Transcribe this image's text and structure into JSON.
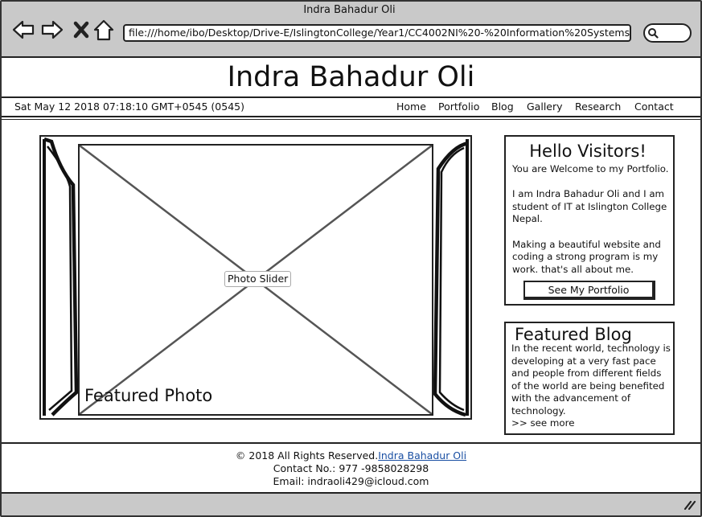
{
  "window": {
    "title": "Indra Bahadur Oli",
    "url": "file:///home/ibo/Desktop/Drive-E/IslingtonCollege/Year1/CC4002NI%20-%20Information%20Systems/"
  },
  "site": {
    "title": "Indra Bahadur Oli"
  },
  "navbar": {
    "datetime": "Sat May 12 2018 07:18:10 GMT+0545 (0545)",
    "links": [
      "Home",
      "Portfolio",
      "Blog",
      "Gallery",
      "Research",
      "Contact"
    ]
  },
  "slider": {
    "placeholder_label": "Photo Slider",
    "caption": "Featured Photo"
  },
  "welcome": {
    "title": "Hello Visitors!",
    "paragraphs": [
      "You are Welcome to my Portfolio.",
      "I am Indra Bahadur Oli and I am student of IT at Islington College Nepal.",
      "Making a beautiful website and coding a strong program is my work. that's all about me."
    ],
    "button": "See My Portfolio"
  },
  "blog": {
    "title": "Featured Blog",
    "text": "In the recent world, technology is developing at a very fast pace and people from different fields of the world are being benefited with the advancement of technology.",
    "more": ">> see more"
  },
  "footer": {
    "copyright_prefix": "© 2018 All Rights Reserved.",
    "copyright_link": "Indra Bahadur Oli",
    "contact": "Contact No.: 977 -9858028298",
    "email": "Email: indraoli429@icloud.com"
  },
  "icons": {
    "back": "arrow-left-icon",
    "forward": "arrow-right-icon",
    "stop": "close-icon",
    "home": "home-icon",
    "search": "search-icon"
  },
  "colors": {
    "chrome_gray": "#c9c9c9",
    "link_blue": "#1a4fa3"
  }
}
